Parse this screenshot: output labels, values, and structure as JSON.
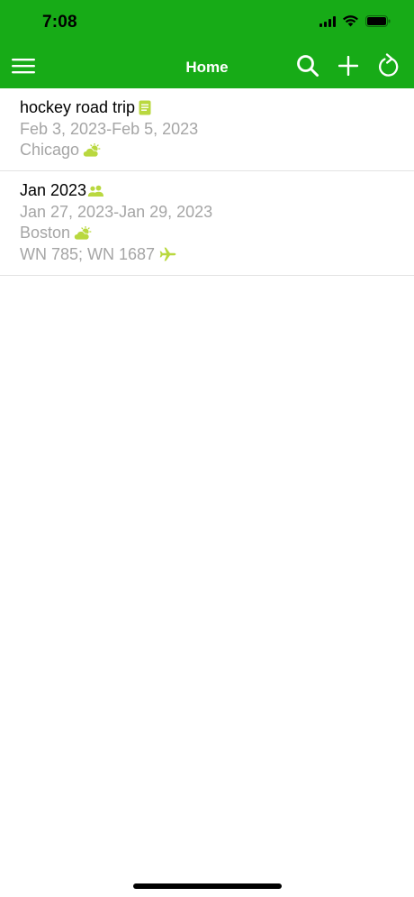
{
  "status_bar": {
    "time": "7:08"
  },
  "navbar": {
    "title": "Home",
    "menu_icon": "hamburger-menu-icon",
    "search_icon": "search-icon",
    "add_icon": "plus-icon",
    "refresh_icon": "refresh-icon"
  },
  "colors": {
    "header_green": "#17ab17",
    "icon_lime": "#b9d83f",
    "subtext_gray": "#a5a5a5"
  },
  "trips": [
    {
      "title": "hockey road trip",
      "title_icon": "document-icon",
      "dates": "Feb 3, 2023-Feb 5, 2023",
      "location": "Chicago",
      "location_icon": "partly-cloudy-icon"
    },
    {
      "title": "Jan 2023",
      "title_icon": "people-icon",
      "dates": "Jan 27, 2023-Jan 29, 2023",
      "location": "Boston",
      "location_icon": "partly-cloudy-icon",
      "flights": "WN 785; WN 1687",
      "flights_icon": "airplane-icon"
    }
  ]
}
